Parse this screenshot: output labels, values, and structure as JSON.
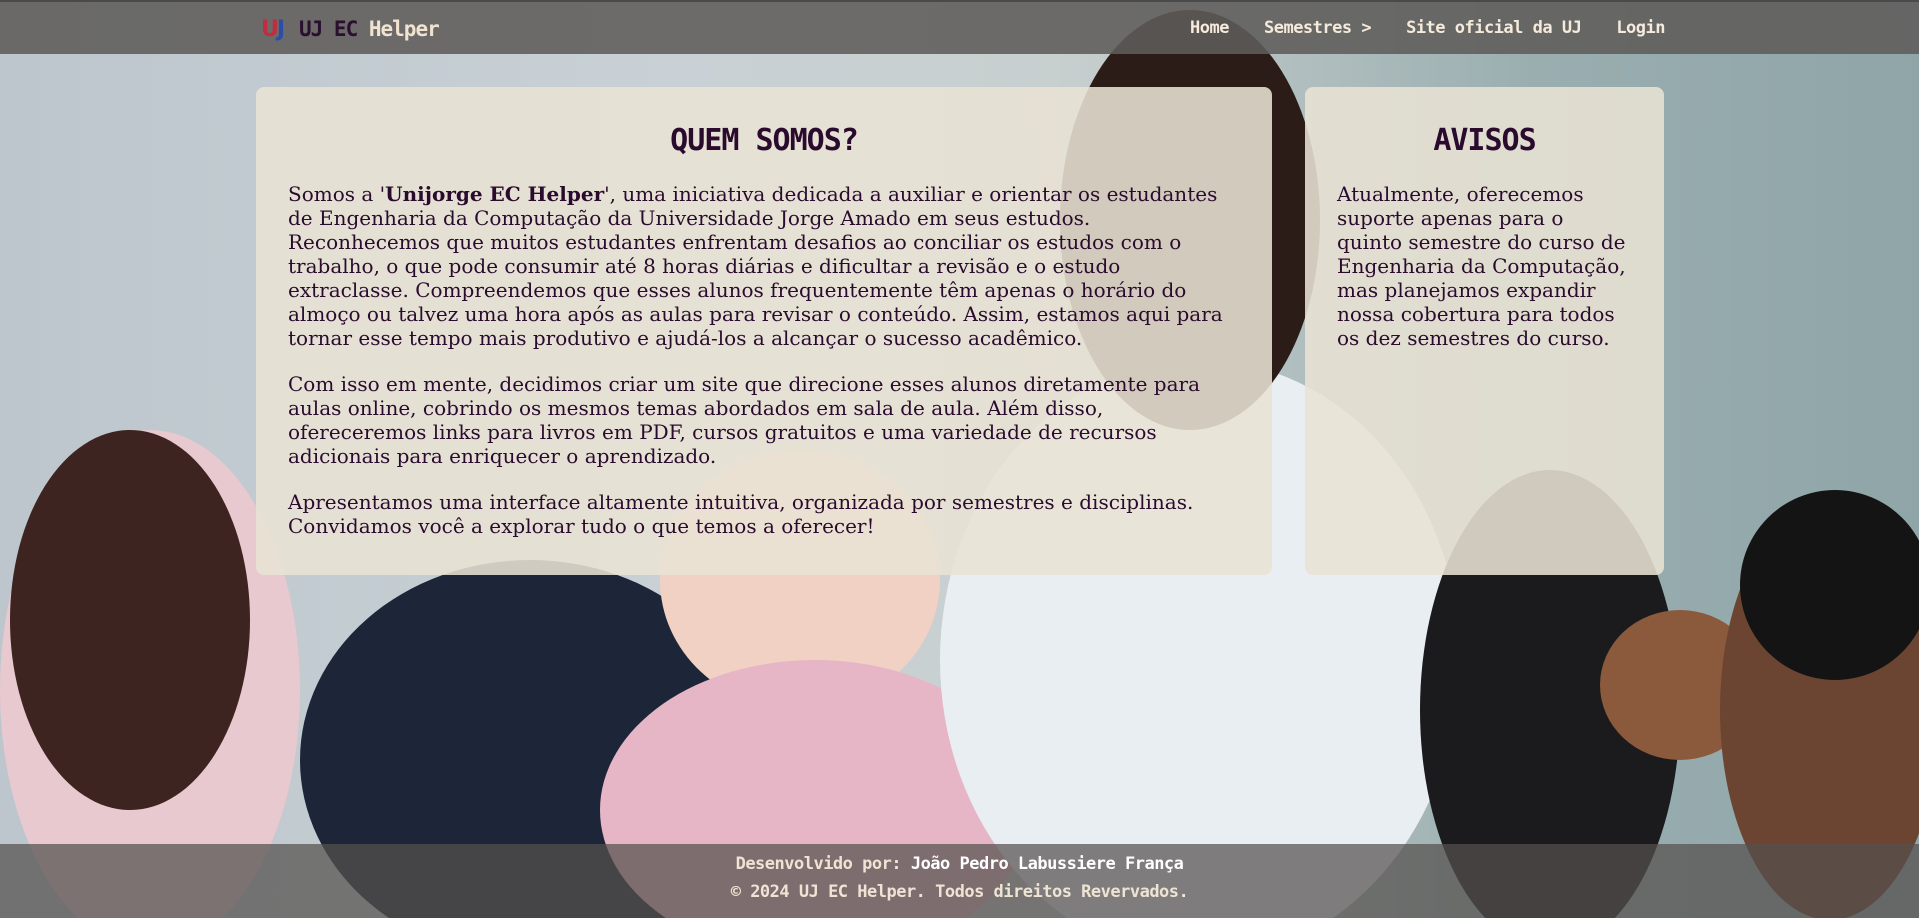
{
  "brand": {
    "logo_left": "U",
    "logo_right": "J",
    "name_part1": "UJ EC",
    "name_part2": "Helper"
  },
  "nav": {
    "items": [
      {
        "label": "Home"
      },
      {
        "label": "Semestres >"
      },
      {
        "label": "Site oficial da UJ"
      },
      {
        "label": "Login"
      }
    ]
  },
  "about": {
    "title": "QUEM SOMOS?",
    "p1_before": "Somos a '",
    "p1_bold": "Unijorge EC Helper",
    "p1_after": "', uma iniciativa dedicada a auxiliar e orientar os estudantes de Engenharia da Computação da Universidade Jorge Amado em seus estudos. Reconhecemos que muitos estudantes enfrentam desafios ao conciliar os estudos com o trabalho, o que pode consumir até 8 horas diárias e dificultar a revisão e o estudo extraclasse. Compreendemos que esses alunos frequentemente têm apenas o horário do almoço ou talvez uma hora após as aulas para revisar o conteúdo. Assim, estamos aqui para tornar esse tempo mais produtivo e ajudá-los a alcançar o sucesso acadêmico.",
    "p2": "Com isso em mente, decidimos criar um site que direcione esses alunos diretamente para aulas online, cobrindo os mesmos temas abordados em sala de aula. Além disso, ofereceremos links para livros em PDF, cursos gratuitos e uma variedade de recursos adicionais para enriquecer o aprendizado.",
    "p3": "Apresentamos uma interface altamente intuitiva, organizada por semestres e disciplinas. Convidamos você a explorar tudo o que temos a oferecer!"
  },
  "notices": {
    "title": "AVISOS",
    "text": "Atualmente, oferecemos suporte apenas para o quinto semestre do curso de Engenharia da Computação, mas planejamos expandir nossa cobertura para todos os dez semestres do curso."
  },
  "footer": {
    "dev_label": "Desenvolvido por:",
    "dev_name": "João Pedro Labussiere França",
    "copyright": "© 2024 UJ EC Helper. Todos direitos Revervados."
  },
  "colors": {
    "heading": "#2a0a2d",
    "nav_text": "#f5eadb",
    "logo_red": "#c22c3d",
    "logo_blue": "#2c4da8"
  }
}
